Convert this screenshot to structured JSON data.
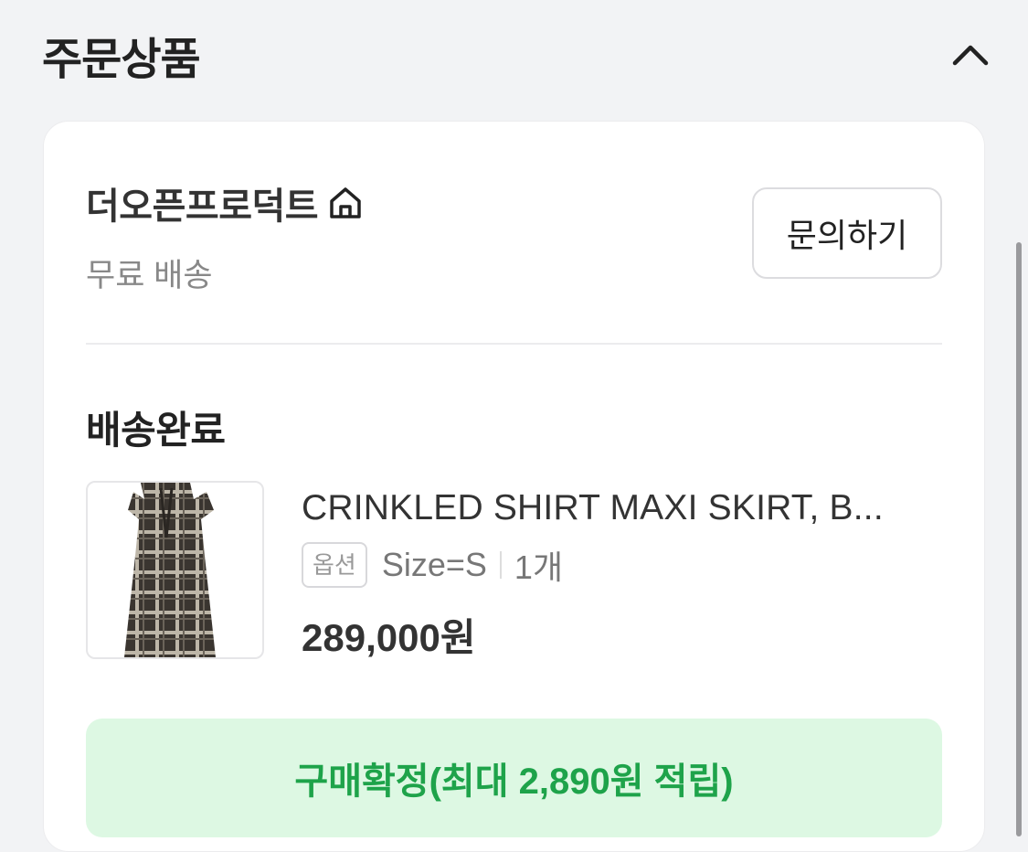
{
  "section": {
    "title": "주문상품",
    "collapse_icon": "chevron-up-icon"
  },
  "seller": {
    "name": "더오픈프로덕트",
    "home_icon": "home-icon",
    "shipping": "무료 배송",
    "inquiry_label": "문의하기"
  },
  "order": {
    "status": "배송완료",
    "product": {
      "name": "CRINKLED SHIRT MAXI SKIRT, B...",
      "option_badge": "옵션",
      "option_value": "Size=S",
      "quantity": "1개",
      "price": "289,000원"
    },
    "confirm_label": "구매확정(최대 2,890원 적립)"
  },
  "colors": {
    "confirm_bg": "#ddf8e3",
    "confirm_text": "#1ea34a",
    "background": "#f2f3f5"
  }
}
